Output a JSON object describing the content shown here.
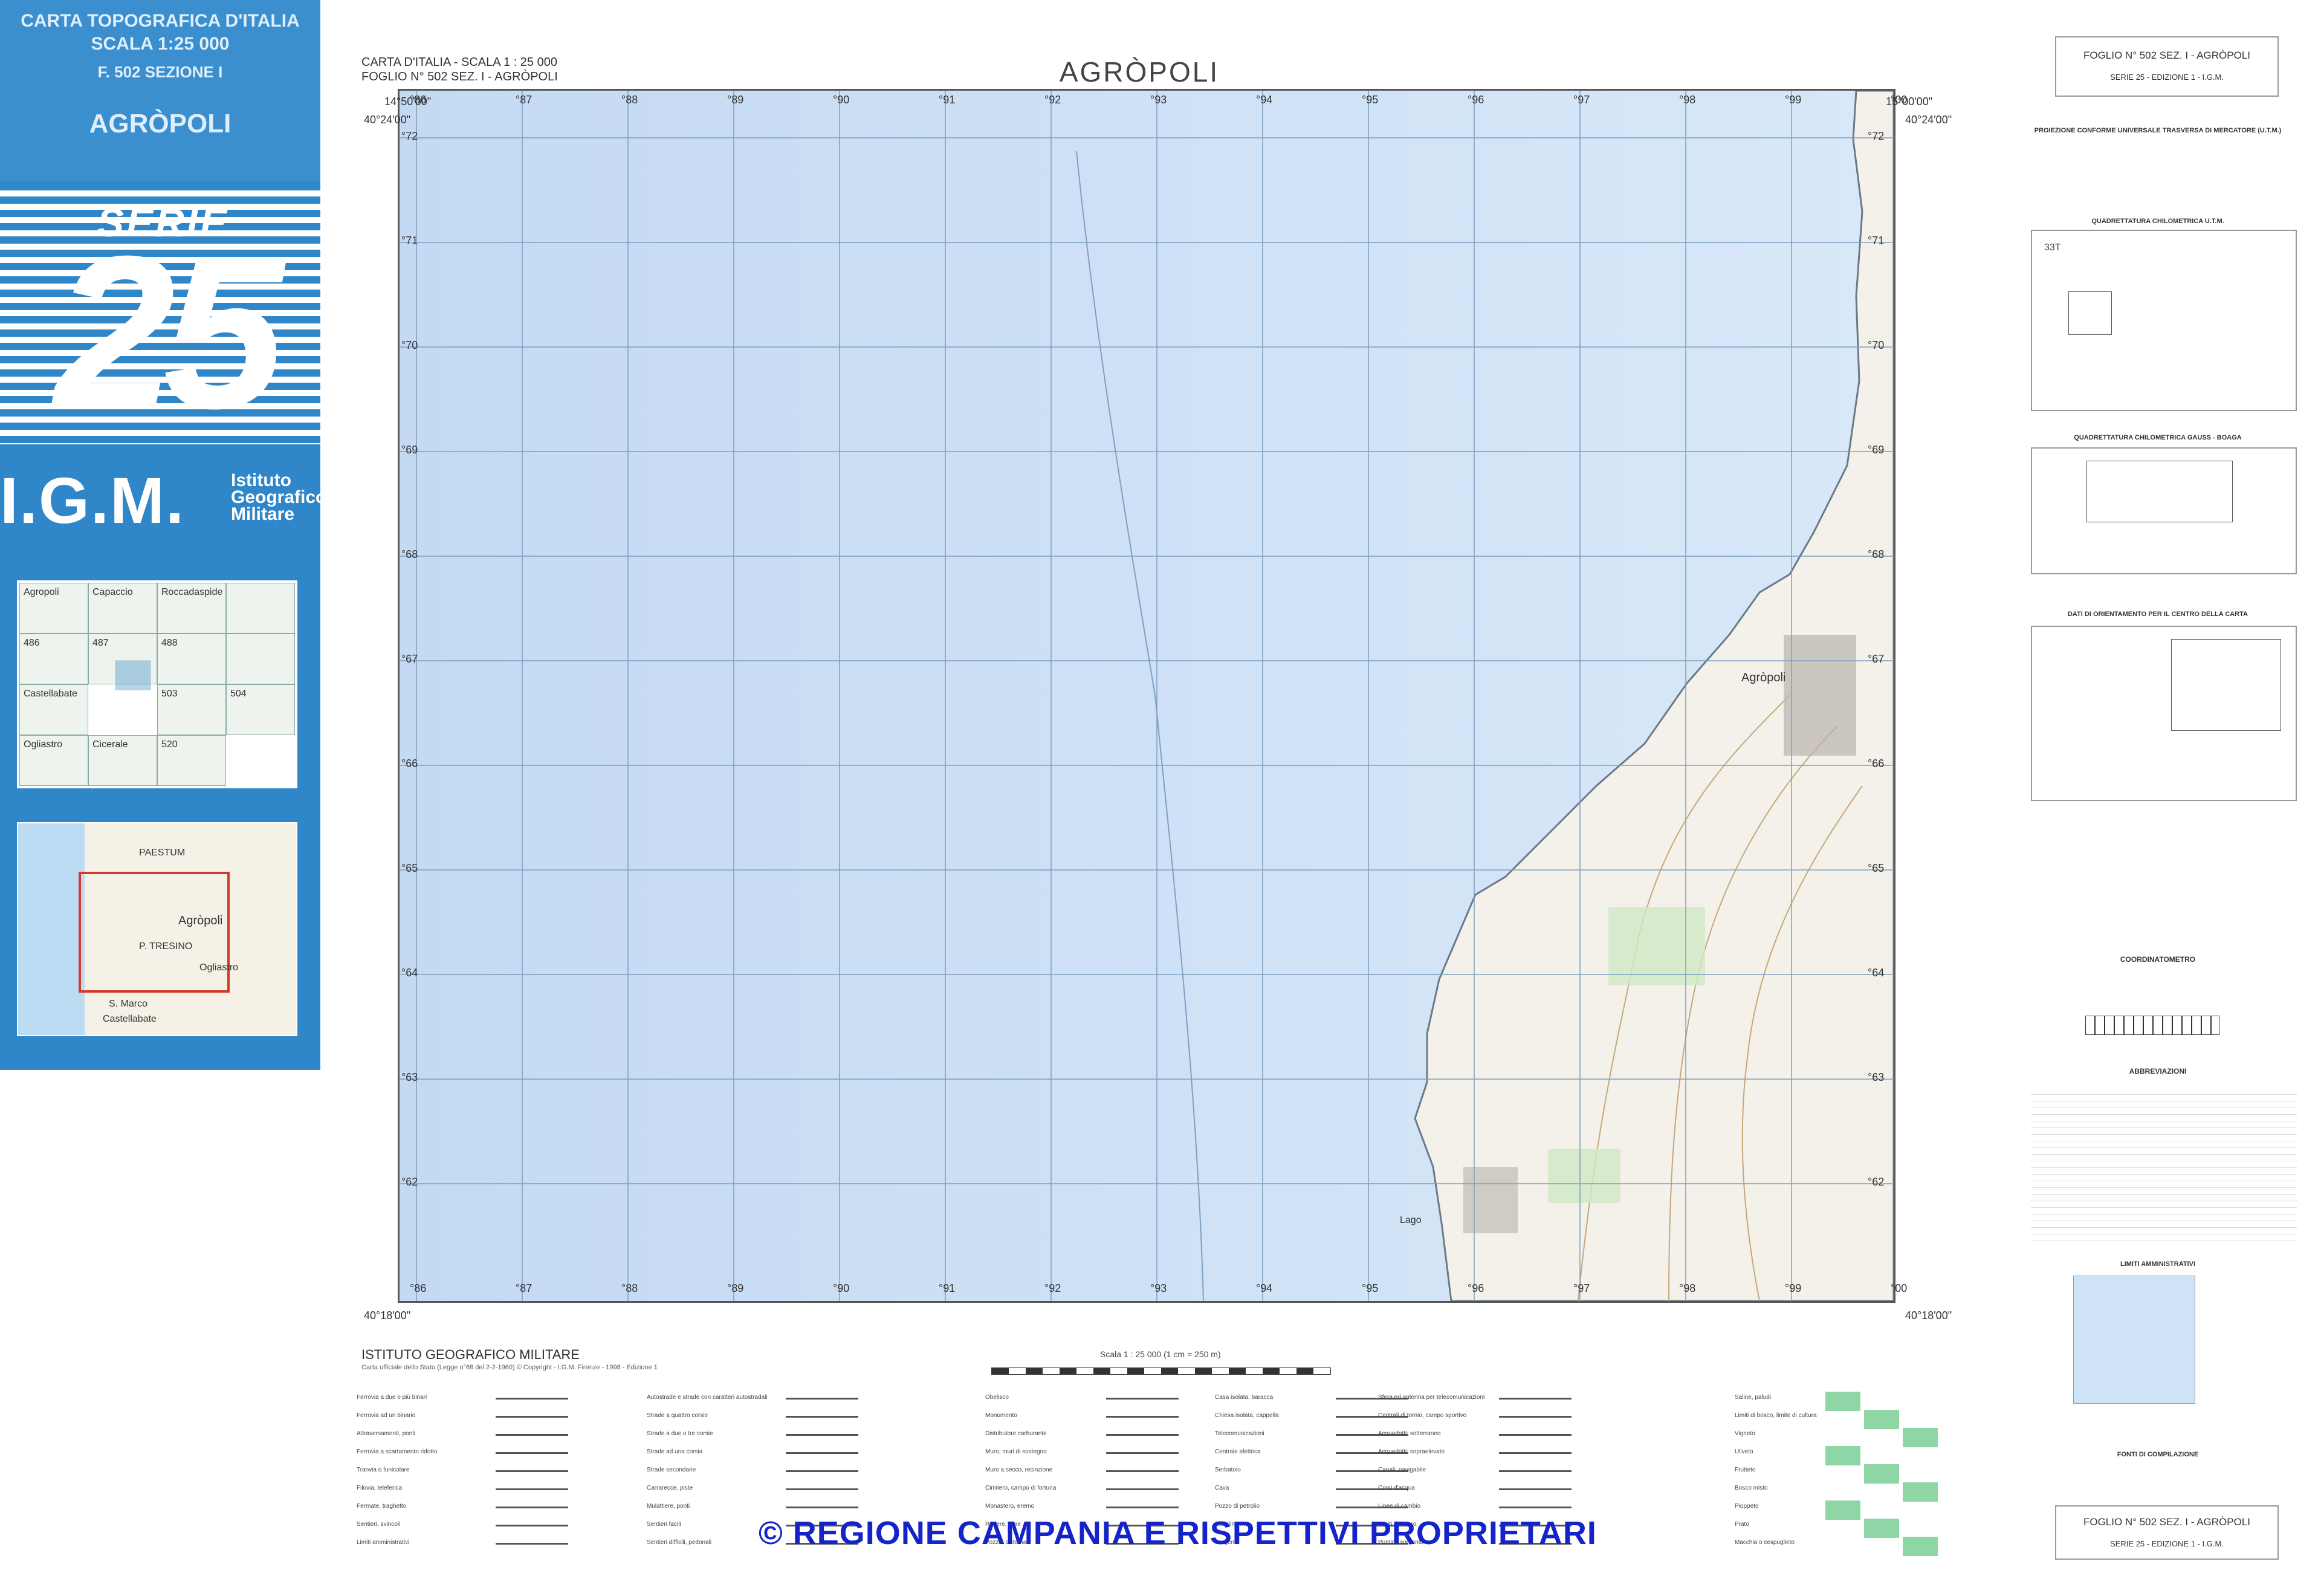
{
  "left_panel": {
    "header_line1": "CARTA TOPOGRAFICA D'ITALIA",
    "header_line2": "SCALA 1:25 000",
    "header_line3": "F. 502 SEZIONE I",
    "header_line4": "AGRÒPOLI",
    "serie_label": "SERIE",
    "serie_number": "25",
    "igm_logo": "I.G.M.",
    "igm_sub1": "Istituto",
    "igm_sub2": "Geografico",
    "igm_sub3": "Militare",
    "index_labels": [
      "486",
      "487",
      "488",
      "503",
      "504",
      "520"
    ],
    "index_cells": [
      "Agropoli",
      "Capaccio",
      "Roccadaspide",
      "Castellabate",
      "Ogliastro",
      "Cicerale"
    ],
    "locator_labels": [
      "PAESTUM",
      "Agròpoli",
      "Castellabate",
      "S. Marco",
      "Ogliastro",
      "P. TRESINO"
    ]
  },
  "map_header": {
    "line1": "CARTA D'ITALIA - SCALA 1 : 25 000",
    "line2": "FOGLIO N° 502 SEZ. I - AGRÒPOLI",
    "title": "AGRÒPOLI"
  },
  "grid": {
    "x_labels": [
      "86",
      "87",
      "88",
      "89",
      "90",
      "91",
      "92",
      "93",
      "94",
      "95",
      "96",
      "97",
      "98",
      "99",
      "00"
    ],
    "y_labels": [
      "72",
      "71",
      "70",
      "69",
      "68",
      "67",
      "66",
      "65",
      "64",
      "63",
      "62"
    ],
    "corner_tl": "40°24'00\"",
    "corner_tr": "40°24'00\"",
    "corner_bl": "40°18'00\"",
    "corner_br": "40°18'00\"",
    "lon_left": "14°50'00\"",
    "lon_right": "15°00'00\"",
    "place_agropoli": "Agròpoli",
    "place_lago": "Lago"
  },
  "footer": {
    "institute": "ISTITUTO GEOGRAFICO MILITARE",
    "note": "Carta ufficiale dello Stato (Legge n°68 del 2-2-1960) © Copyright - I.G.M. Firenze - 1998 - Edizione 1",
    "scale_label": "Scala 1 : 25 000  (1 cm = 250 m)"
  },
  "right_panel": {
    "sheet_label_top": "FOGLIO N° 502 SEZ. I - AGRÒPOLI",
    "serie_top": "SERIE 25 - EDIZIONE 1 - I.G.M.",
    "projection_title": "PROIEZIONE CONFORME UNIVERSALE TRASVERSA DI MERCATORE (U.T.M.)",
    "quad_utm_title": "QUADRETTATURA CHILOMETRICA U.T.M.",
    "zone_label": "33T",
    "quad_gauss_title": "QUADRETTATURA CHILOMETRICA GAUSS - BOAGA",
    "orient_title": "DATI DI ORIENTAMENTO PER IL CENTRO DELLA CARTA",
    "coord_title": "COORDINATOMETRO",
    "abbr_title": "ABBREVIAZIONI",
    "limits_title": "LIMITI AMMINISTRATIVI",
    "sources_title": "FONTI DI COMPILAZIONE",
    "sheet_label_bottom": "FOGLIO N° 502 SEZ. I - AGRÒPOLI",
    "serie_bottom": "SERIE 25 - EDIZIONE 1 - I.G.M."
  },
  "legend": {
    "col1": [
      "Ferrovia a due o più binari",
      "Ferrovia ad un binario",
      "Attraversamenti, ponti",
      "Ferrovia a scartamento ridotto",
      "Tranvia o funicolare",
      "Filovia, teleferica",
      "Fermate, traghetto",
      "Sentieri, svincoli",
      "Limiti amministrativi"
    ],
    "col2": [
      "Autostrade e strade con caratteri autostradali",
      "Strade a quattro corsie",
      "Strade a due o tre corsie",
      "Strade ad una corsia",
      "Strade secondarie",
      "Carrarecce, piste",
      "Mulattiere, ponti",
      "Sentieri facili",
      "Sentieri difficili, pedonali"
    ],
    "col3": [
      "Obelisco",
      "Monumento",
      "Distributore carburante",
      "Muro, muri di sostegno",
      "Muro a secco, recinzione",
      "Cimitero, campo di fortuna",
      "Monastero, eremo",
      "Rudere, torre",
      "Pozzo, cisterna"
    ],
    "col4": [
      "Casa isolata, baracca",
      "Chiesa isolata, cappella",
      "Telecomunicazioni",
      "Centrale elettrica",
      "Serbatoio",
      "Cava",
      "Pozzo di petrolio",
      "Stabilimento",
      "Sorgente"
    ],
    "col5": [
      "Sfera ed antenna per telecomunicazioni",
      "Centrali di tornio, campo sportivo",
      "Acquedotti: sotterraneo",
      "Acquedotti: sopraelevato",
      "Canali: navigabile",
      "Corsi d'acqua",
      "Linee di cambio",
      "Limiti di bosco",
      "Puntini, sorgente"
    ],
    "col6": [
      "Saline, paludi",
      "Limiti di bosco, limite di cultura",
      "Vigneto",
      "Uliveto",
      "Frutteto",
      "Bosco misto",
      "Pioppeto",
      "Prato",
      "Macchia o cespuglieto"
    ]
  },
  "watermark": "© REGIONE CAMPANIA E RISPETTIVI PROPRIETARI"
}
